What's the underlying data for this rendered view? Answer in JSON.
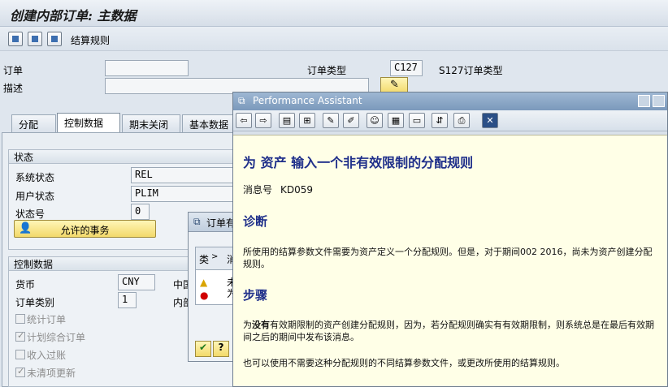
{
  "window": {
    "title": "创建内部订单: 主数据"
  },
  "toolbar": {
    "settlement_rule_label": "结算规则"
  },
  "header": {
    "order_label": "订单",
    "order_value": "",
    "description_label": "描述",
    "description_value": "",
    "order_type_label": "订单类型",
    "order_type_value": "C127",
    "order_type_text": "S127订单类型"
  },
  "tabs": [
    "分配",
    "控制数据",
    "期末关闭",
    "基本数据"
  ],
  "status_group": {
    "title": "状态",
    "system_status_label": "系统状态",
    "system_status_value": "REL",
    "user_status_label": "用户状态",
    "user_status_value": "PLIM",
    "status_number_label": "状态号",
    "status_number_value": "0",
    "allowed_transactions_button": "允许的事务"
  },
  "control_group": {
    "title": "控制数据",
    "currency_label": "货币",
    "currency_value": "CNY",
    "currency_extra": "中国",
    "order_category_label": "订单类别",
    "order_category_value": "1",
    "order_category_extra": "内部",
    "checkboxes": [
      {
        "label": "统计订单",
        "checked": false
      },
      {
        "label": "计划综合订单",
        "checked": true
      },
      {
        "label": "收入过账",
        "checked": false
      },
      {
        "label": "未清项更新",
        "checked": true
      }
    ]
  },
  "small_dialog": {
    "title": "订单有",
    "col1": "类",
    "col2": "消",
    "row1_text": "未",
    "row2_text": "为"
  },
  "pa": {
    "title": "Performance Assistant",
    "heading": "为 资产 输入一个非有效限制的分配规则",
    "message_no_label": "消息号",
    "message_no": "KD059",
    "diag_heading": "诊断",
    "diag_text": "所使用的结算参数文件需要为资产定义一个分配规则。但是，对于期间002 2016，尚未为资产创建分配规则。",
    "steps_heading": "步骤",
    "steps_text_pre": "为",
    "steps_text_bold": "没有",
    "steps_text_post": "有效期限制的资产创建分配规则，因为，若分配规则确实有有效期限制，则系统总是在最后有效期间之后的期间中发布该消息。",
    "steps_text2": "也可以使用不需要这种分配规则的不同结算参数文件，或更改所使用的结算规则。"
  }
}
